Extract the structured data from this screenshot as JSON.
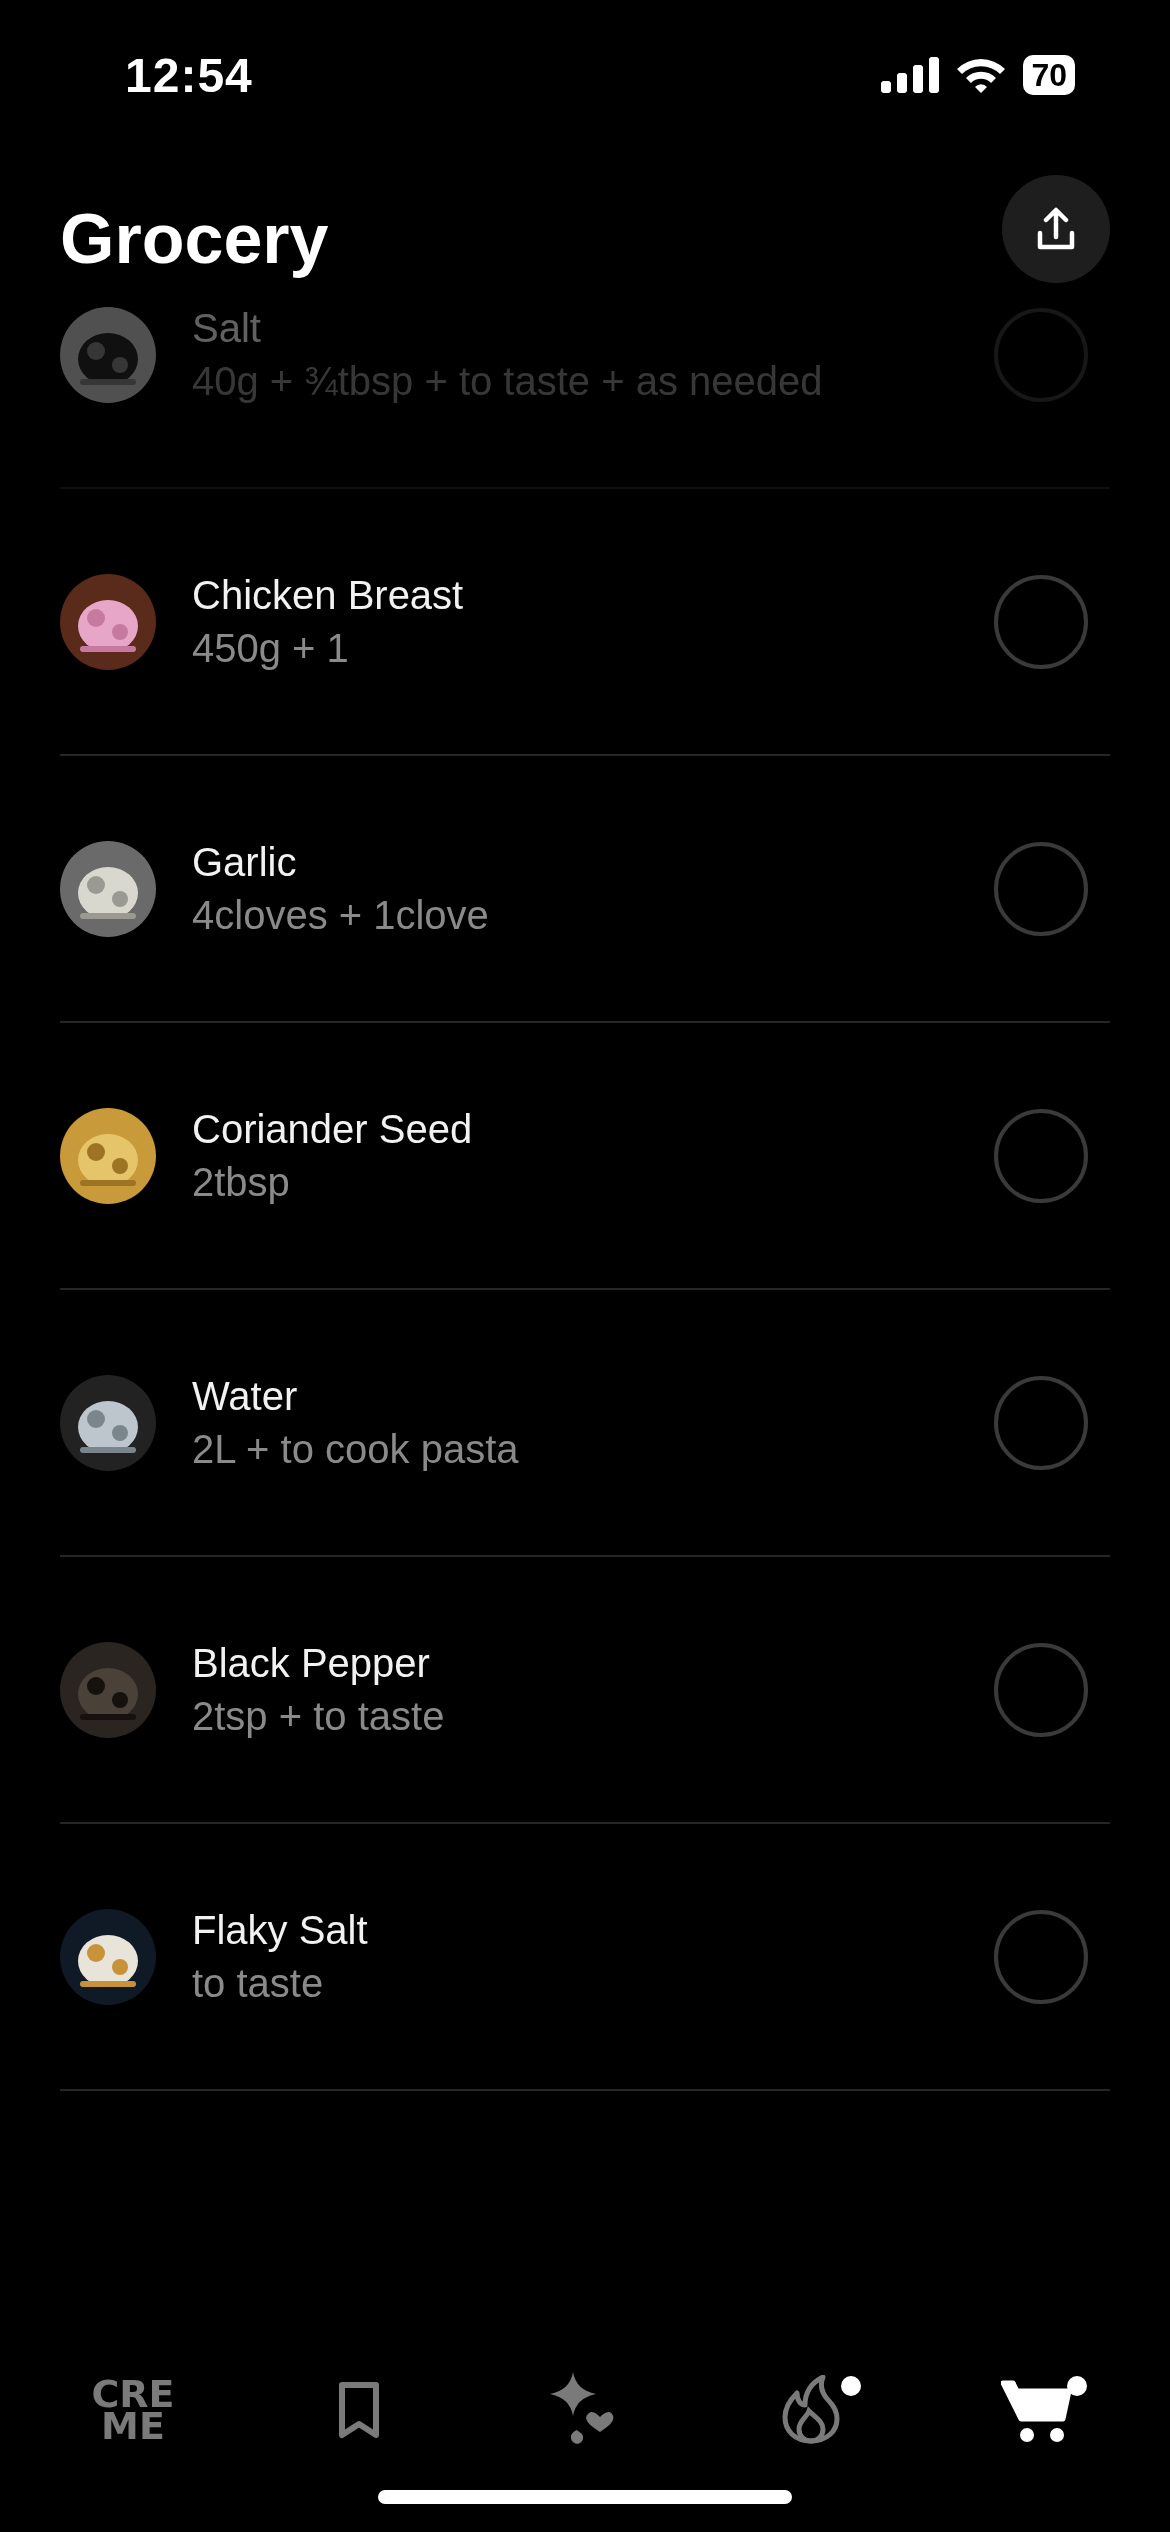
{
  "status_bar": {
    "time": "12:54",
    "battery": "70"
  },
  "header": {
    "title": "Grocery"
  },
  "items": [
    {
      "name": "Salt",
      "amount": "40g + ¾tbsp + to taste + as needed",
      "checked": false,
      "faded": true
    },
    {
      "name": "Chicken Breast",
      "amount": "450g + 1",
      "checked": false,
      "faded": false
    },
    {
      "name": "Garlic",
      "amount": "4cloves + 1clove",
      "checked": false,
      "faded": false
    },
    {
      "name": "Coriander Seed",
      "amount": "2tbsp",
      "checked": false,
      "faded": false
    },
    {
      "name": "Water",
      "amount": "2L + to cook pasta",
      "checked": false,
      "faded": false
    },
    {
      "name": "Black Pepper",
      "amount": "2tsp + to taste",
      "checked": false,
      "faded": false
    },
    {
      "name": "Flaky Salt",
      "amount": "to taste",
      "checked": false,
      "faded": false
    }
  ],
  "tab_bar": {
    "logo_lines": [
      "CRE",
      "ME"
    ],
    "tabs": [
      {
        "kind": "logo",
        "selected": false,
        "badge": false
      },
      {
        "kind": "bookmark",
        "selected": false,
        "badge": false
      },
      {
        "kind": "sparkle",
        "selected": false,
        "badge": false
      },
      {
        "kind": "flame",
        "selected": false,
        "badge": true
      },
      {
        "kind": "cart",
        "selected": true,
        "badge": true
      }
    ]
  }
}
